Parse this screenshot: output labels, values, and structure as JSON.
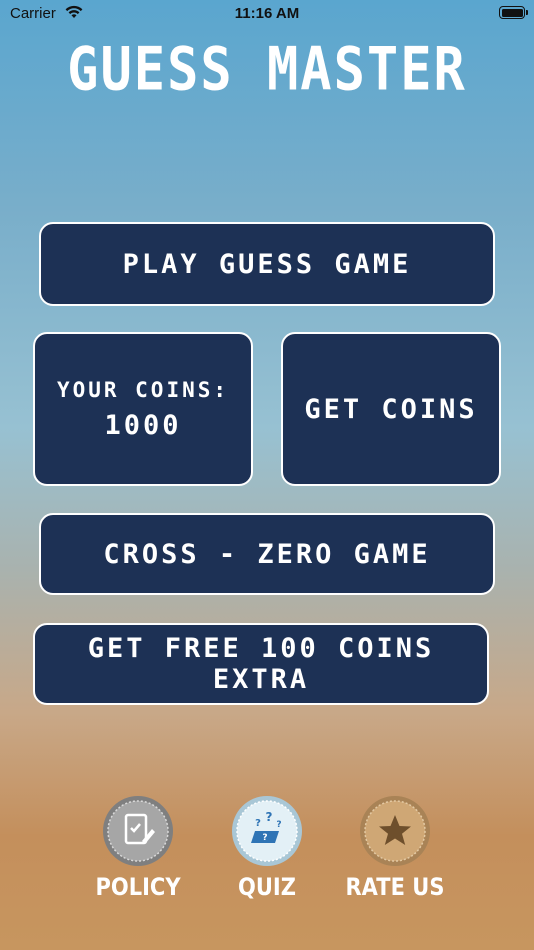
{
  "status_bar": {
    "carrier": "Carrier",
    "time": "11:16 AM"
  },
  "app": {
    "title": "GUESS MASTER"
  },
  "buttons": {
    "play": "PLAY GUESS GAME",
    "coins_label": "YOUR COINS:",
    "coins_value": "1000",
    "get_coins": "GET COINS",
    "cross_zero": "CROSS - ZERO GAME",
    "free_coins": "GET FREE 100 COINS EXTRA"
  },
  "bottom_nav": {
    "policy": "POLICY",
    "quiz": "QUIZ",
    "rate": "RATE US"
  },
  "icons": {
    "policy": "policy-document-icon",
    "quiz": "quiz-laptop-icon",
    "rate": "star-icon"
  },
  "colors": {
    "button_bg": "#1d3155",
    "button_border": "#ffffff",
    "policy_badge": "#9a9a9a",
    "quiz_badge": "#cfe4ef",
    "rate_badge": "#c9a06c"
  }
}
